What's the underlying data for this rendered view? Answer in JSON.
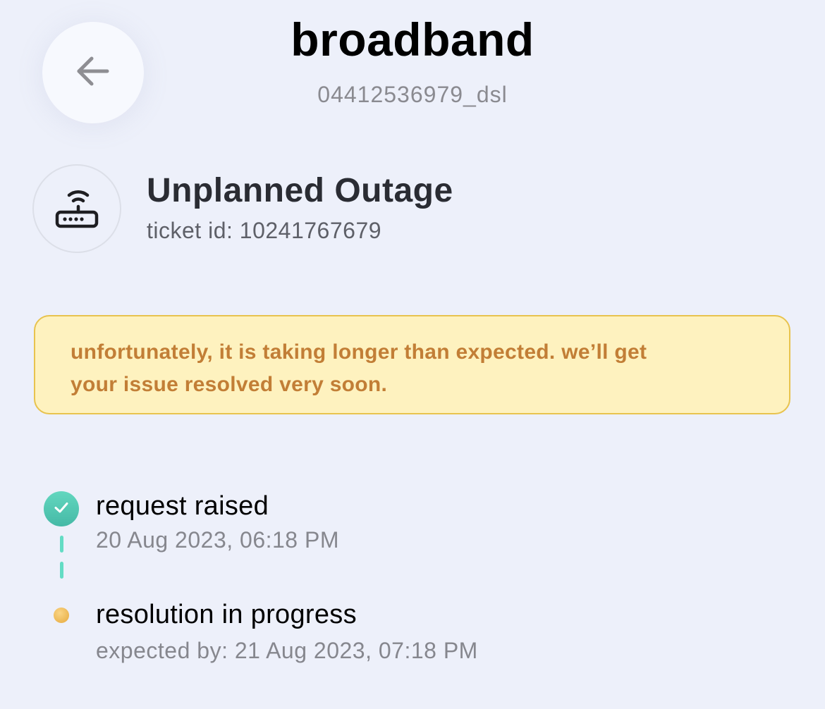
{
  "header": {
    "title": "broadband",
    "subtitle": "04412536979_dsl",
    "back_icon": "arrow-left-icon"
  },
  "issue": {
    "icon": "router-icon",
    "title": "Unplanned Outage",
    "ticket": "ticket id: 10241767679"
  },
  "alert": {
    "line1": "unfortunately, it is taking longer than expected. we’ll get",
    "line2": "your issue resolved very soon.",
    "background": "#FEF2BF",
    "border": "#E8C34E",
    "text_color": "#C27E36"
  },
  "timeline": {
    "steps": [
      {
        "title": "request raised",
        "subtitle": "20 Aug 2023, 06:18 PM",
        "status": "completed",
        "icon": "check-icon",
        "color": "#4EC7B2"
      },
      {
        "title": "resolution in progress",
        "subtitle": "expected by: 21 Aug 2023, 07:18 PM",
        "status": "in-progress",
        "color": "#F0B84E"
      }
    ]
  }
}
